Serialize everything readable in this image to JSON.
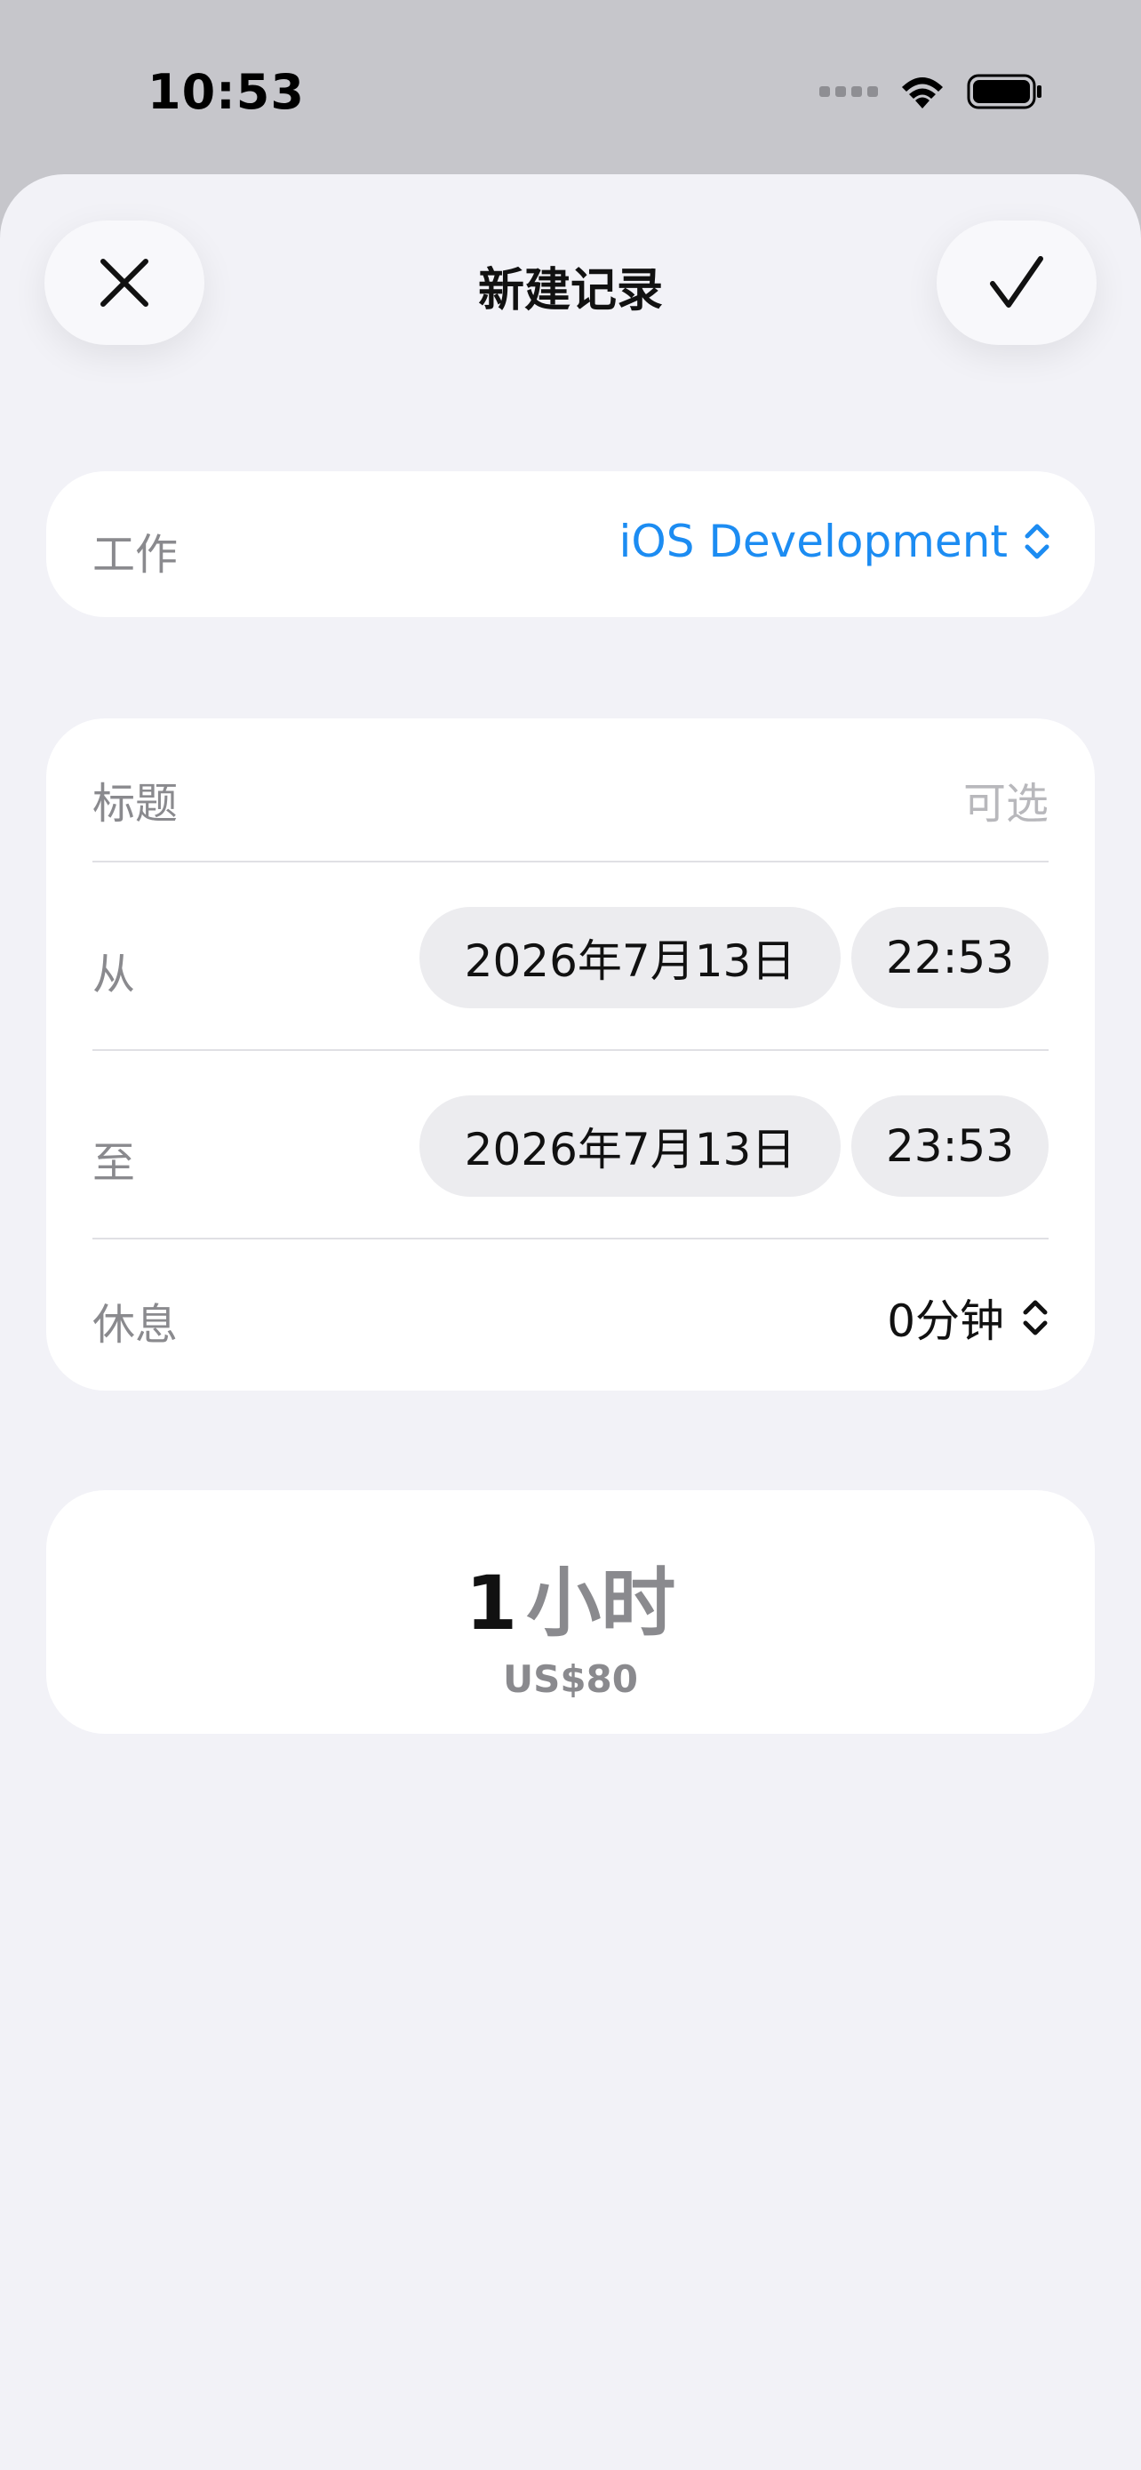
{
  "status_bar": {
    "time": "10:53"
  },
  "header": {
    "title": "新建记录",
    "close_icon": "xmark-icon",
    "done_icon": "checkmark-icon"
  },
  "work": {
    "label": "工作",
    "value": "iOS Development",
    "accent_color": "#1c8cf2"
  },
  "form": {
    "title_label": "标题",
    "title_placeholder": "可选",
    "from_label": "从",
    "from_date": "2026年7月13日",
    "from_time": "22:53",
    "to_label": "至",
    "to_date": "2026年7月13日",
    "to_time": "23:53",
    "break_label": "休息",
    "break_value": "0分钟"
  },
  "summary": {
    "duration_number": "1",
    "duration_unit": "小时",
    "price": "US$80"
  }
}
